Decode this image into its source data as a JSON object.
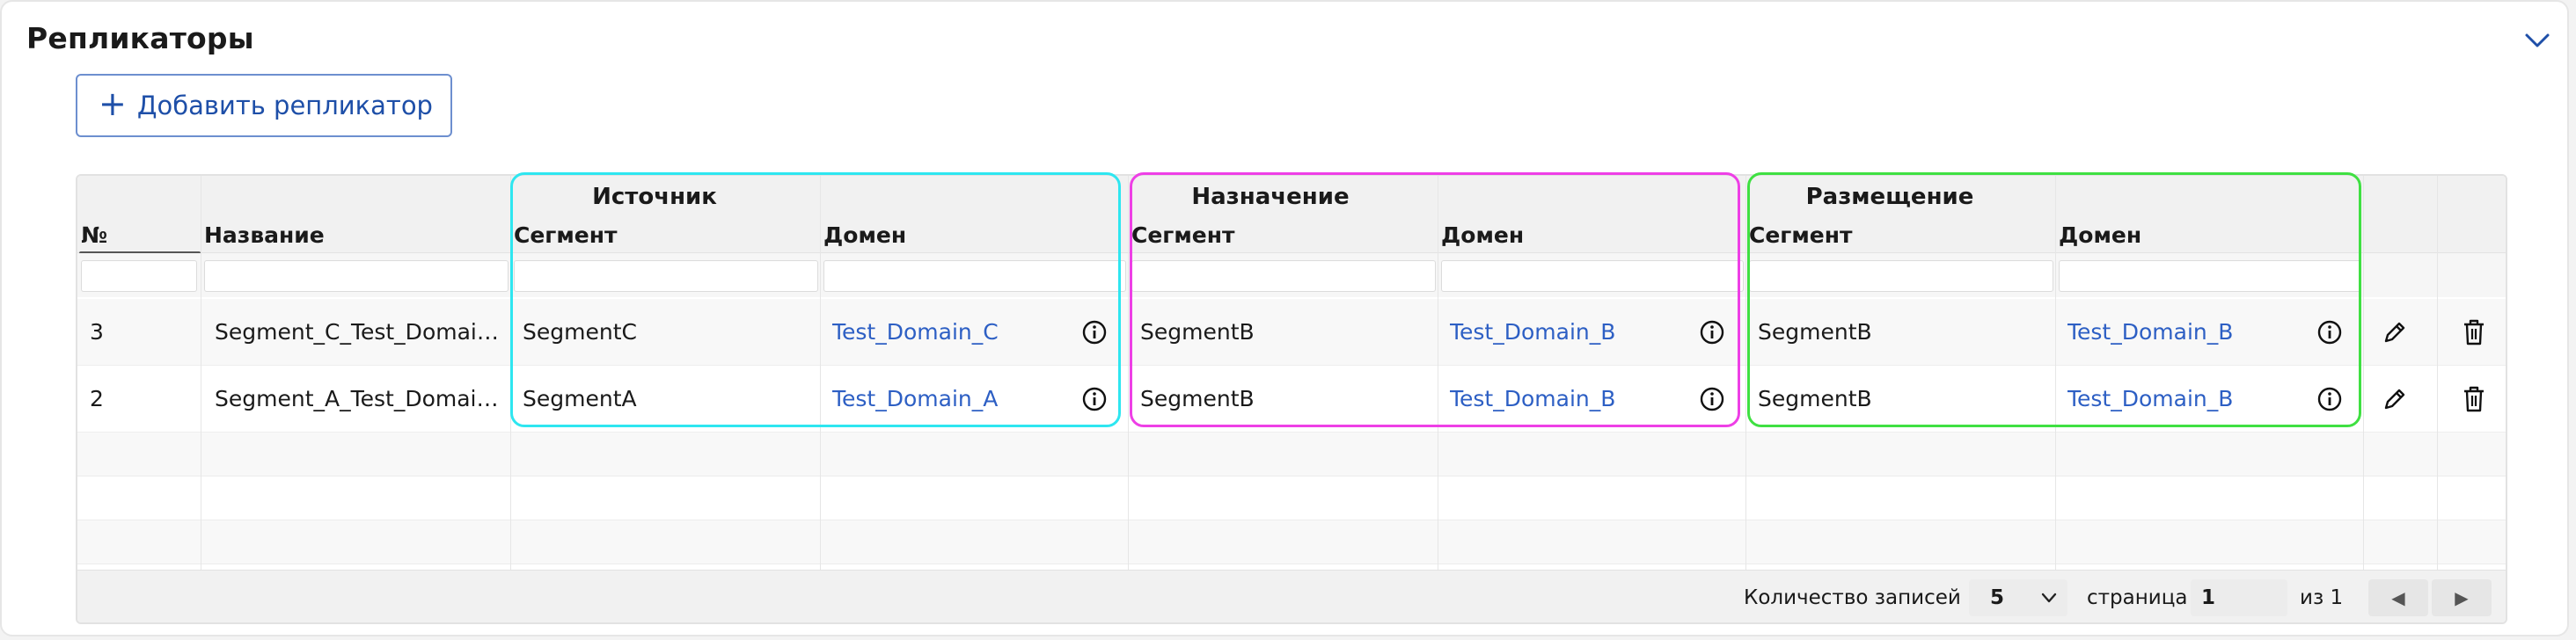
{
  "panel": {
    "title": "Репликаторы"
  },
  "toolbar": {
    "add_plus": "+",
    "add_label": "Добавить репликатор"
  },
  "groups": {
    "source": "Источник",
    "destination": "Назначение",
    "placement": "Размещение"
  },
  "columns": {
    "num": "№",
    "name": "Название",
    "src_segment": "Сегмент",
    "src_domain": "Домен",
    "dst_segment": "Сегмент",
    "dst_domain": "Домен",
    "plc_segment": "Сегмент",
    "plc_domain": "Домен"
  },
  "rows": [
    {
      "num": "3",
      "name": "Segment_C_Test_Domain_C",
      "src_segment": "SegmentC",
      "src_domain": "Test_Domain_C",
      "dst_segment": "SegmentB",
      "dst_domain": "Test_Domain_B",
      "plc_segment": "SegmentB",
      "plc_domain": "Test_Domain_B"
    },
    {
      "num": "2",
      "name": "Segment_A_Test_Domain_A",
      "src_segment": "SegmentA",
      "src_domain": "Test_Domain_A",
      "dst_segment": "SegmentB",
      "dst_domain": "Test_Domain_B",
      "plc_segment": "SegmentB",
      "plc_domain": "Test_Domain_B"
    }
  ],
  "footer": {
    "records_label": "Количество записей",
    "page_size": "5",
    "page_label": "страница",
    "page_value": "1",
    "page_total": "из 1",
    "prev_icon": "◀",
    "next_icon": "▶"
  },
  "colors": {
    "source_highlight": "#2ee6f0",
    "destination_highlight": "#ee3fe6",
    "placement_highlight": "#3fe042",
    "link": "#2d5fc4",
    "accent": "#1e4fa8"
  }
}
